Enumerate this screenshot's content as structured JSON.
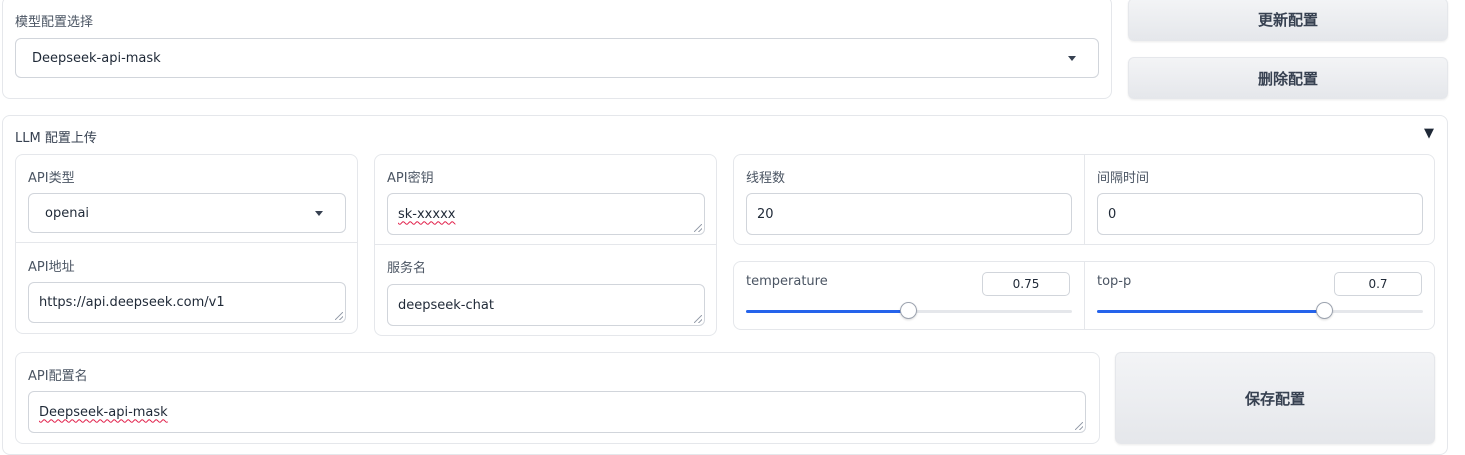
{
  "model_select": {
    "label": "模型配置选择",
    "value": "Deepseek-api-mask",
    "update_button": "更新配置",
    "delete_button": "删除配置"
  },
  "llm_upload": {
    "title": "LLM 配置上传",
    "toggle_icon": "▼",
    "api_type": {
      "label": "API类型",
      "value": "openai"
    },
    "api_key": {
      "label": "API密钥",
      "value": "sk-xxxxx"
    },
    "api_url": {
      "label": "API地址",
      "value": "https://api.deepseek.com/v1"
    },
    "service_name": {
      "label": "服务名",
      "value": "deepseek-chat"
    },
    "threads": {
      "label": "线程数",
      "value": "20"
    },
    "interval": {
      "label": "间隔时间",
      "value": "0"
    },
    "temperature": {
      "label": "temperature",
      "value": "0.75",
      "fraction": 0.5
    },
    "top_p": {
      "label": "top-p",
      "value": "0.7",
      "fraction": 0.7
    },
    "config_name": {
      "label": "API配置名",
      "value": "Deepseek-api-mask"
    },
    "save_button": "保存配置"
  },
  "colors": {
    "accent": "#2563eb",
    "border": "#e5e7eb",
    "button": "#e5e7eb"
  }
}
